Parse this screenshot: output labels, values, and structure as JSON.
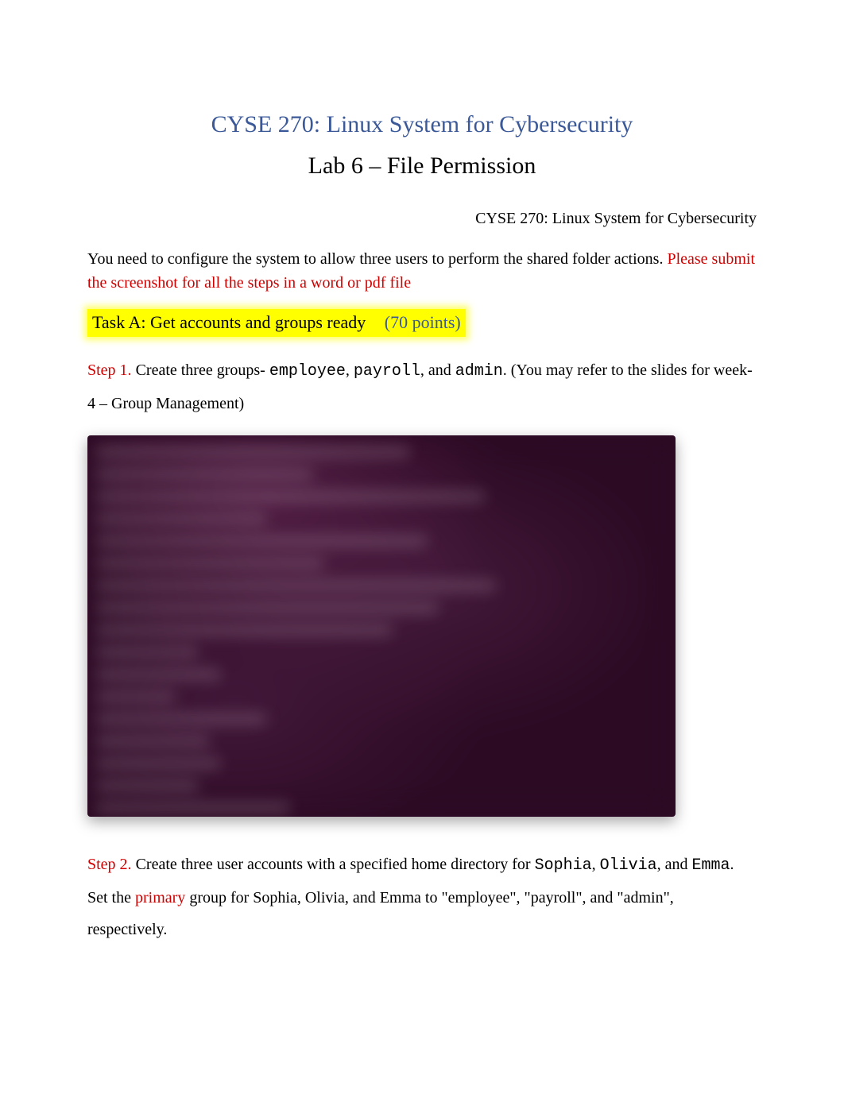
{
  "course_title": "CYSE 270: Linux System for Cybersecurity",
  "lab_title": "Lab 6 – File Permission",
  "header_right": "CYSE 270: Linux System for Cybersecurity",
  "intro": {
    "text": "You need to configure the system to allow three users to perform the shared folder actions.     ",
    "instruction": "Please submit the screenshot for all the steps in a word or pdf file"
  },
  "task_a": {
    "label": "Task A: Get accounts and groups ready",
    "points": "(70 points)"
  },
  "step1": {
    "label": "Step 1.",
    "before_groups": "Create three groups- ",
    "g1": "employee",
    "sep1": ", ",
    "g2": "payroll",
    "sep2": ", and ",
    "g3": "admin",
    "after_groups": ". (You may refer to the slides for week-4 – Group Management)"
  },
  "step2": {
    "label": "Step 2.",
    "before_names": "Create three user accounts with a specified home directory for   ",
    "n1": "Sophia",
    "s1": ", ",
    "n2": "Olivia",
    "s2": ", and ",
    "n3": "Emma",
    "after_names_1": ". Set the ",
    "primary": "primary",
    "after_names_2": " group for Sophia, Olivia, and Emma to \"employee\", \"payroll\", and \"admin\", respectively."
  }
}
